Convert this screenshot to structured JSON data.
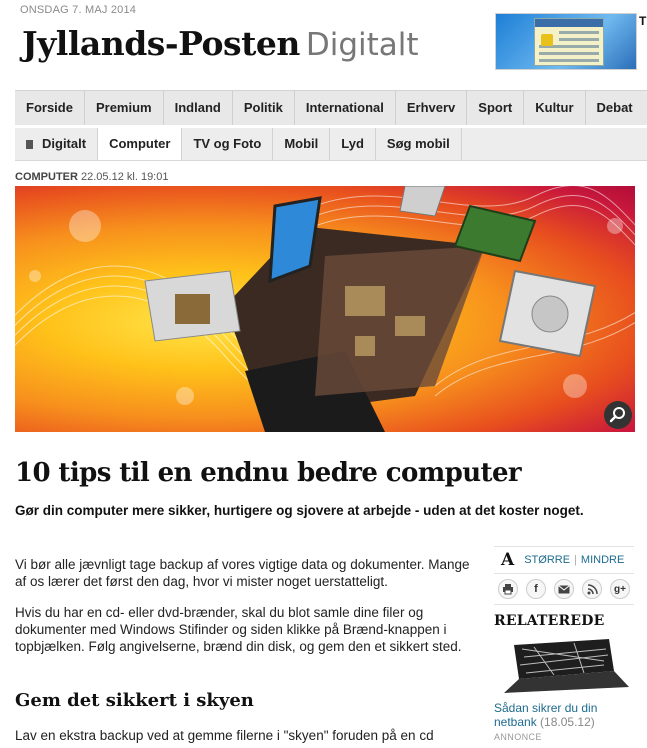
{
  "header": {
    "date": "ONSDAG 7. MAJ 2014",
    "logo_main": "Jyllands-Posten",
    "logo_sub": "Digitalt",
    "top_right_cut": "T"
  },
  "nav_main": [
    {
      "label": "Forside"
    },
    {
      "label": "Premium"
    },
    {
      "label": "Indland"
    },
    {
      "label": "Politik"
    },
    {
      "label": "International"
    },
    {
      "label": "Erhverv"
    },
    {
      "label": "Sport"
    },
    {
      "label": "Kultur"
    },
    {
      "label": "Debat"
    }
  ],
  "nav_sub": [
    {
      "label": "Digitalt"
    },
    {
      "label": "Computer"
    },
    {
      "label": "TV og Foto"
    },
    {
      "label": "Mobil"
    },
    {
      "label": "Lyd"
    },
    {
      "label": "Søg mobil"
    }
  ],
  "article": {
    "section": "COMPUTER",
    "timestamp": "22.05.12 kl. 19:01",
    "title": "10 tips til en endnu bedre computer",
    "lead": "Gør din computer mere sikker, hurtigere og sjovere at arbejde - uden at det koster noget.",
    "p1": "Vi bør alle jævnligt tage backup af vores vigtige data og dokumenter. Mange af os lærer det først den dag, hvor vi mister noget uerstatteligt.",
    "p2": "Hvis du har en cd- eller dvd-brænder, skal du blot samle dine filer og dokumenter med Windows Stifinder og siden klikke på Brænd-knappen i topbjælken. Følg angivelserne, brænd din disk, og gem den et sikkert sted.",
    "subheading": "Gem det sikkert i skyen",
    "p3": "Lav en ekstra backup ved at gemme filerne i \"skyen\" foruden på en cd"
  },
  "sidebar": {
    "font_letter": "A",
    "larger": "STØRRE",
    "divider": "|",
    "smaller": "MINDRE",
    "share_icons": [
      "print-icon",
      "facebook-icon",
      "email-icon",
      "rss-icon",
      "google-plus-icon"
    ],
    "related_title": "RELATEREDE",
    "related_item_text": "Sådan sikrer du din netbank",
    "related_item_date": "(18.05.12)",
    "annonce": "ANNONCE"
  },
  "colors": {
    "nav_bg": "#e8e8e8",
    "link": "#1d6b8e",
    "hero_orange": "#f7901d",
    "hero_red": "#c9183b"
  }
}
